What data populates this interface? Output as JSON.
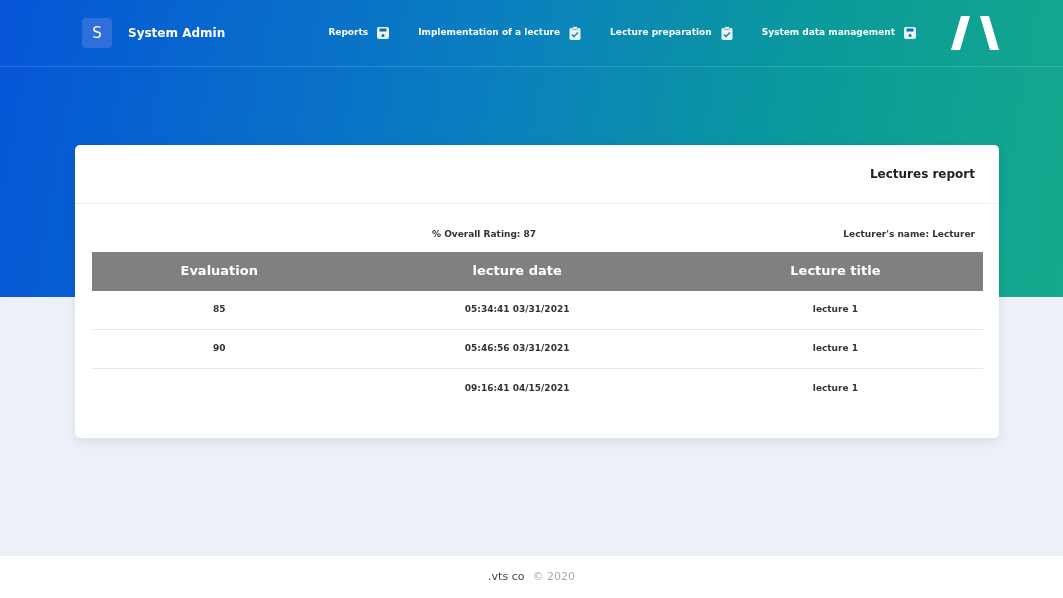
{
  "brand": {
    "initial": "S",
    "name": "System Admin"
  },
  "nav": [
    {
      "label": "Reports",
      "kind": "save"
    },
    {
      "label": "Implementation of a lecture",
      "kind": "clipboard"
    },
    {
      "label": "Lecture preparation",
      "kind": "clipboard"
    },
    {
      "label": "System data management",
      "kind": "save"
    }
  ],
  "card": {
    "title": "Lectures report",
    "overall_rating": "% Overall Rating: 87",
    "lecturer_name": "Lecturer's name: Lecturer"
  },
  "table": {
    "columns": [
      "Evaluation",
      "lecture date",
      "Lecture title"
    ],
    "rows": [
      [
        "85",
        "05:34:41 03/31/2021",
        "lecture 1"
      ],
      [
        "90",
        "05:46:56 03/31/2021",
        "lecture 1"
      ],
      [
        null,
        "09:16:41 04/15/2021",
        "lecture 1"
      ]
    ]
  },
  "footer": {
    "company": ".vts co",
    "copyright": "© 2020"
  }
}
